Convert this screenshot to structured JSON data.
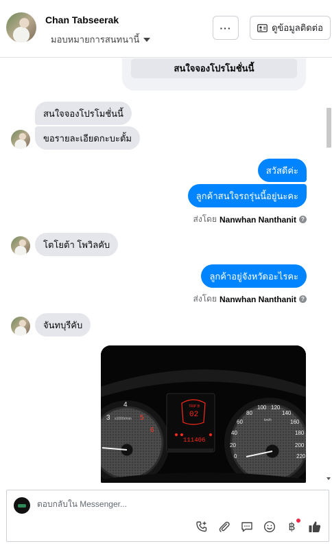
{
  "header": {
    "contact_name": "Chan Tabseerak",
    "assign_label": "มอบหมายการสนทนานี้",
    "more_label": "···",
    "contact_info_label": "ดูข้อมูลติดต่อ"
  },
  "messages": {
    "card_button": "สนใจจองโปรโมชั่นนี้",
    "in_1": "สนใจจองโปรโมชั่นนี้",
    "in_2": "ขอรายละเอียดกะบะตั้ม",
    "out_1": "สวัสดีค่ะ",
    "out_2": "ลูกค้าสนใจรถรุ่นนี้อยู่นะคะ",
    "sent_by_1_prefix": "ส่งโดย",
    "sent_by_1_name": "Nanwhan Nanthanit",
    "in_3": "โตโยต้า โพวิลคับ",
    "out_3": "ลูกค้าอยู่จังหวัดอะไรคะ",
    "sent_by_2_prefix": "ส่งโดย",
    "sent_by_2_name": "Nanwhan Nanthanit",
    "in_4": "จันทบุรีคับ"
  },
  "photo": {
    "trip_label": "TRIP B",
    "trip_value": "02",
    "odometer": "111406",
    "tach_unit": "x1000r/min",
    "speed_unit": "km/h",
    "speed_ticks": [
      "0",
      "20",
      "40",
      "60",
      "80",
      "100",
      "120",
      "140",
      "160",
      "180",
      "200",
      "220"
    ],
    "tach_ticks": [
      "3",
      "4",
      "5",
      "6"
    ]
  },
  "composer": {
    "placeholder": "ตอบกลับใน Messenger..."
  },
  "icons": {
    "call": "phone-add-icon",
    "attach": "paperclip-icon",
    "saved_replies": "chat-bubble-icon",
    "emoji": "smiley-icon",
    "payment": "baht-icon",
    "like": "thumbs-up-icon"
  },
  "colors": {
    "outgoing_bubble": "#0084ff",
    "incoming_bubble": "#e4e6eb",
    "notification_dot": "#f02849",
    "dash_red": "#ff2a1a"
  }
}
